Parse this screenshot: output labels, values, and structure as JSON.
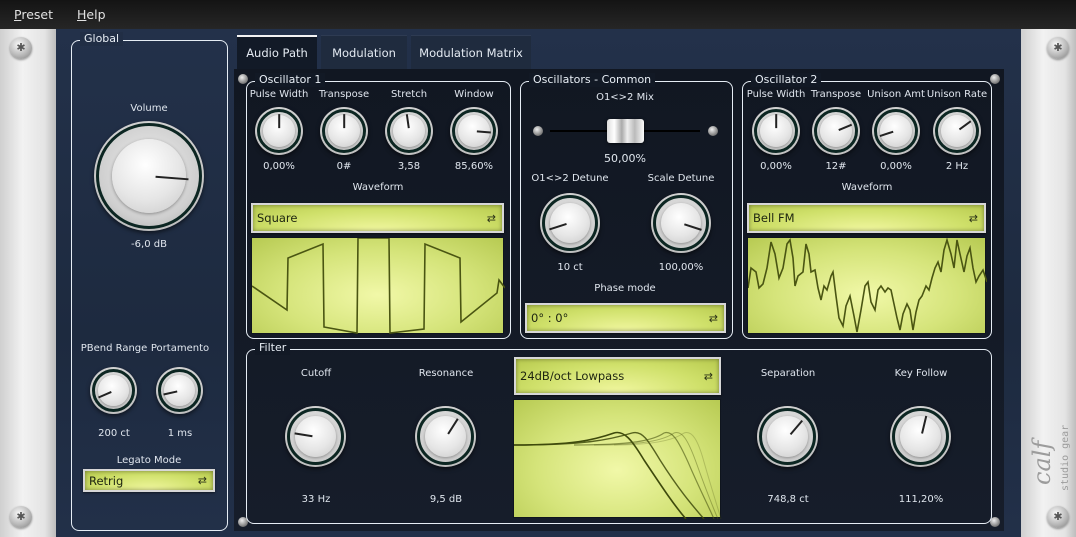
{
  "menu": [
    {
      "label": "Preset",
      "accel": "P"
    },
    {
      "label": "Help",
      "accel": "H"
    }
  ],
  "global": {
    "title": "Global",
    "volume": {
      "label": "Volume",
      "value": "-6,0 dB",
      "fraction": 0.85
    },
    "pbend": {
      "label": "PBend Range",
      "value": "200 ct",
      "fraction": 0.08
    },
    "portamento": {
      "label": "Portamento",
      "value": "1 ms",
      "fraction": 0.12
    },
    "legato": {
      "label": "Legato Mode",
      "value": "Retrig"
    }
  },
  "tabs": [
    {
      "label": "Audio Path",
      "active": true
    },
    {
      "label": "Modulation",
      "active": false
    },
    {
      "label": "Modulation Matrix",
      "active": false
    }
  ],
  "osc1": {
    "title": "Oscillator 1",
    "knobs": [
      {
        "label": "Pulse Width",
        "value": "0,00%",
        "fraction": 0.5
      },
      {
        "label": "Transpose",
        "value": "0#",
        "fraction": 0.5
      },
      {
        "label": "Stretch",
        "value": "3,58",
        "fraction": 0.47
      },
      {
        "label": "Window",
        "value": "85,60%",
        "fraction": 0.85
      }
    ],
    "waveform_label": "Waveform",
    "waveform": "Square"
  },
  "common": {
    "title": "Oscillators - Common",
    "mix": {
      "label": "O1<>2 Mix",
      "value": "50,00%",
      "fraction": 0.5
    },
    "detune": {
      "label": "O1<>2 Detune",
      "value": "10 ct",
      "fraction": 0.1
    },
    "scale_detune": {
      "label": "Scale Detune",
      "value": "100,00%",
      "fraction": 0.9
    },
    "phase_label": "Phase mode",
    "phase": "0° : 0°"
  },
  "osc2": {
    "title": "Oscillator 2",
    "knobs": [
      {
        "label": "Pulse Width",
        "value": "0,00%",
        "fraction": 0.5
      },
      {
        "label": "Transpose",
        "value": "12#",
        "fraction": 0.75
      },
      {
        "label": "Unison Amt",
        "value": "0,00%",
        "fraction": 0.1
      },
      {
        "label": "Unison Rate",
        "value": "2 Hz",
        "fraction": 0.7
      }
    ],
    "waveform_label": "Waveform",
    "waveform": "Bell FM"
  },
  "filter": {
    "title": "Filter",
    "cutoff": {
      "label": "Cutoff",
      "value": "33 Hz",
      "fraction": 0.2
    },
    "resonance": {
      "label": "Resonance",
      "value": "9,5 dB",
      "fraction": 0.62
    },
    "type": "24dB/oct Lowpass",
    "separation": {
      "label": "Separation",
      "value": "748,8 ct",
      "fraction": 0.65
    },
    "keyfollow": {
      "label": "Key Follow",
      "value": "111,20%",
      "fraction": 0.55
    }
  },
  "brand": {
    "logo": "calf",
    "tagline": "studio gear"
  },
  "icons": {
    "cycle": "⇄"
  }
}
